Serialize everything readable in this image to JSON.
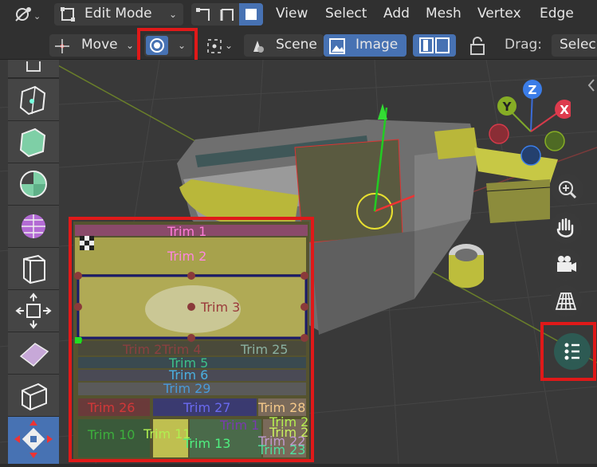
{
  "header": {
    "mode_label": "Edit Mode",
    "menus": [
      "View",
      "Select",
      "Add",
      "Mesh",
      "Vertex",
      "Edge"
    ]
  },
  "toolbar": {
    "transform_label": "Move",
    "orientation_scene_label": "Scene",
    "orientation_image_label": "Image",
    "drag_label": "Drag:",
    "drag_value": "Selec"
  },
  "gizmo": {
    "z": "Z",
    "y": "Y",
    "x": "X"
  },
  "trims": {
    "t1": "Trim 1",
    "t2": "Trim 2",
    "t3": "Trim 3",
    "t4": "Trim 2Trim 4",
    "t25": "Trim 25",
    "t5": "Trim 5",
    "t6": "Trim 6",
    "t29": "Trim 29",
    "t26": "Trim 26",
    "t27": "Trim 27",
    "t28": "Trim 28",
    "t1b": "Trim 1",
    "t20": "Trim 20",
    "t21": "Trim 21",
    "t10": "Trim 10",
    "t11": "Trim 11",
    "t13": "Trim 13",
    "t22": "Trim 22",
    "t23": "Trim 23"
  },
  "colors": {
    "accent": "#4772b3",
    "highlight": "#e01919"
  }
}
